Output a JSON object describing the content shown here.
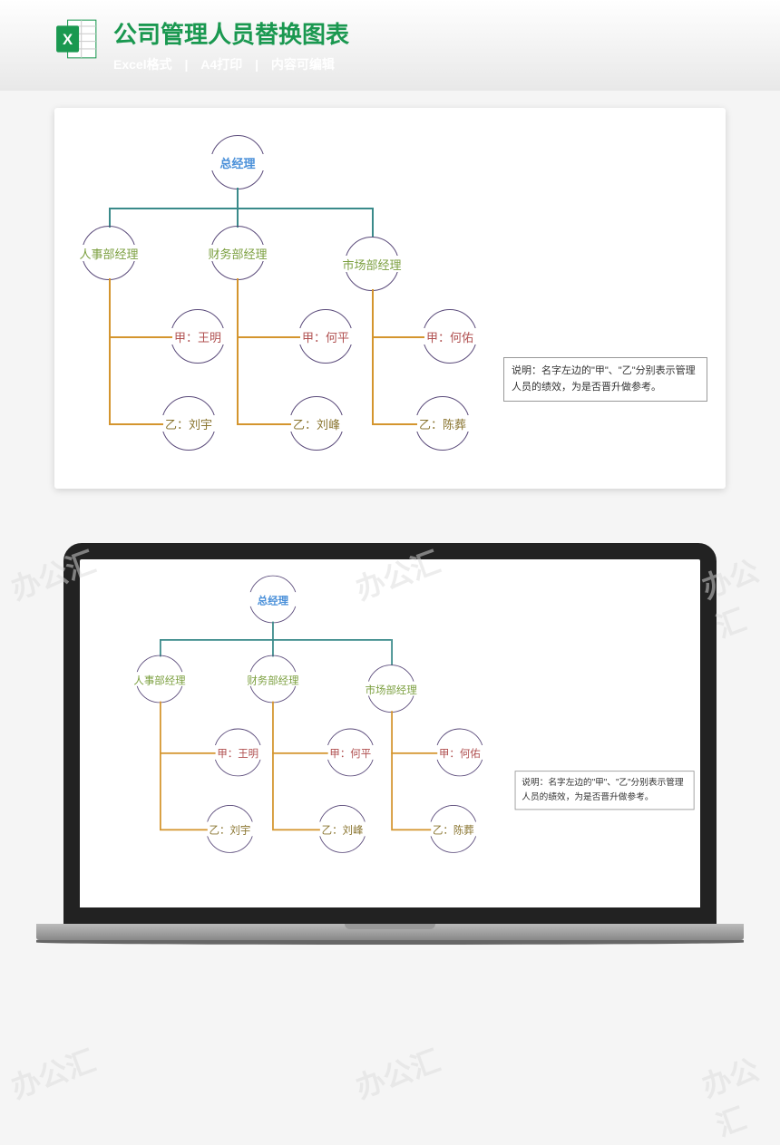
{
  "header": {
    "title": "公司管理人员替换图表",
    "sub1": "Excel格式",
    "sub2": "A4打印",
    "sub3": "内容可编辑"
  },
  "org": {
    "root": "总经理",
    "depts": [
      {
        "name": "人事部经理",
        "jia": "甲：王明",
        "yi": "乙：刘宇"
      },
      {
        "name": "财务部经理",
        "jia": "甲：何平",
        "yi": "乙：刘峰"
      },
      {
        "name": "市场部经理",
        "jia": "甲：何佑",
        "yi": "乙：陈葬"
      }
    ]
  },
  "note": "说明：名字左边的\"甲\"、\"乙\"分别表示管理 人员的绩效，为是否晋升做参考。",
  "watermark": "办公汇"
}
